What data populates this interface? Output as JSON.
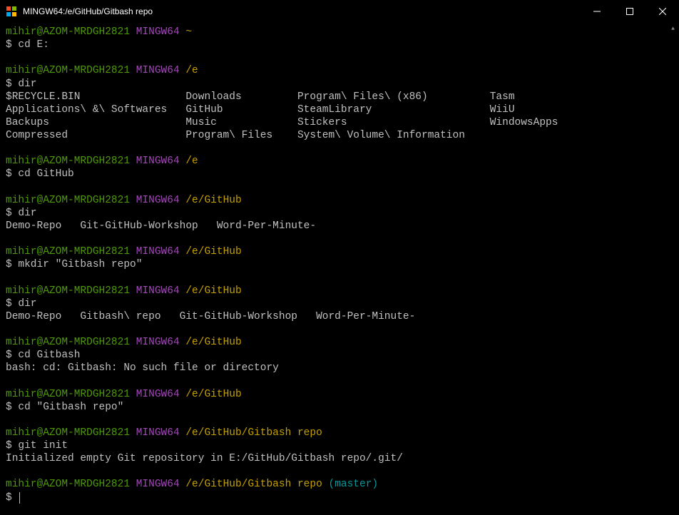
{
  "titlebar": {
    "title": "MINGW64:/e/GitHub/Gitbash repo"
  },
  "prompts": {
    "user": "mihir@AZOM-MRDGH2821",
    "host": "MINGW64",
    "dollar": "$"
  },
  "blocks": [
    {
      "path": "~",
      "cmd": "cd E:",
      "output": ""
    },
    {
      "path": "/e",
      "cmd": "dir",
      "output": "$RECYCLE.BIN                 Downloads         Program\\ Files\\ (x86)          Tasm\nApplications\\ &\\ Softwares   GitHub            SteamLibrary                   WiiU\nBackups                      Music             Stickers                       WindowsApps\nCompressed                   Program\\ Files    System\\ Volume\\ Information"
    },
    {
      "path": "/e",
      "cmd": "cd GitHub",
      "output": ""
    },
    {
      "path": "/e/GitHub",
      "cmd": "dir",
      "output": "Demo-Repo   Git-GitHub-Workshop   Word-Per-Minute-"
    },
    {
      "path": "/e/GitHub",
      "cmd": "mkdir \"Gitbash repo\"",
      "output": ""
    },
    {
      "path": "/e/GitHub",
      "cmd": "dir",
      "output": "Demo-Repo   Gitbash\\ repo   Git-GitHub-Workshop   Word-Per-Minute-"
    },
    {
      "path": "/e/GitHub",
      "cmd": "cd Gitbash",
      "output": "bash: cd: Gitbash: No such file or directory"
    },
    {
      "path": "/e/GitHub",
      "cmd": "cd \"Gitbash repo\"",
      "output": ""
    },
    {
      "path": "/e/GitHub/Gitbash repo",
      "cmd": "git init",
      "output": "Initialized empty Git repository in E:/GitHub/Gitbash repo/.git/"
    },
    {
      "path": "/e/GitHub/Gitbash repo",
      "branch": "(master)",
      "cmd": "",
      "output": "",
      "cursor": true
    }
  ]
}
